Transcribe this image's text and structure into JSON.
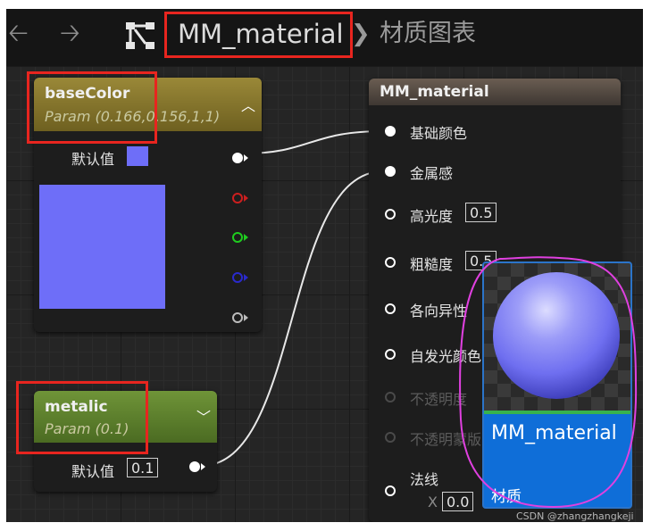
{
  "toolbar": {
    "back_label": "🡠",
    "forward_label": "🡢",
    "asset_name": "MM_material",
    "separator": "❯",
    "graph_label": "材质图表"
  },
  "nodes": {
    "base_color": {
      "title": "baseColor",
      "subtitle": "Param (0.166,0.156,1,1)",
      "default_label": "默认值",
      "color": "#6e6ef8",
      "header_color": "#8a7a2a"
    },
    "metalic": {
      "title": "metalic",
      "subtitle": "Param (0.1)",
      "default_label": "默认值",
      "default_value": "0.1",
      "header_color": "#5d7f2e"
    },
    "material": {
      "title": "MM_material",
      "inputs": [
        {
          "label": "基础颜色"
        },
        {
          "label": "金属感"
        },
        {
          "label": "高光度",
          "value": "0.5"
        },
        {
          "label": "粗糙度",
          "value": "0.5"
        },
        {
          "label": "各向异性"
        },
        {
          "label": "自发光颜色"
        },
        {
          "label": "不透明度"
        },
        {
          "label": "不透明蒙版"
        },
        {
          "label": "法线",
          "sub_label": "X",
          "sub_value": "0.0"
        }
      ]
    }
  },
  "preview": {
    "name": "MM_material",
    "type": "材质"
  },
  "watermark": "CSDN @zhangzhangkeji",
  "colors": {
    "highlight": "#e8251f",
    "annotation": "#e040e0",
    "pin_red": "#cc1f1f",
    "pin_green": "#1fcc1f",
    "pin_blue": "#2a2acc"
  }
}
